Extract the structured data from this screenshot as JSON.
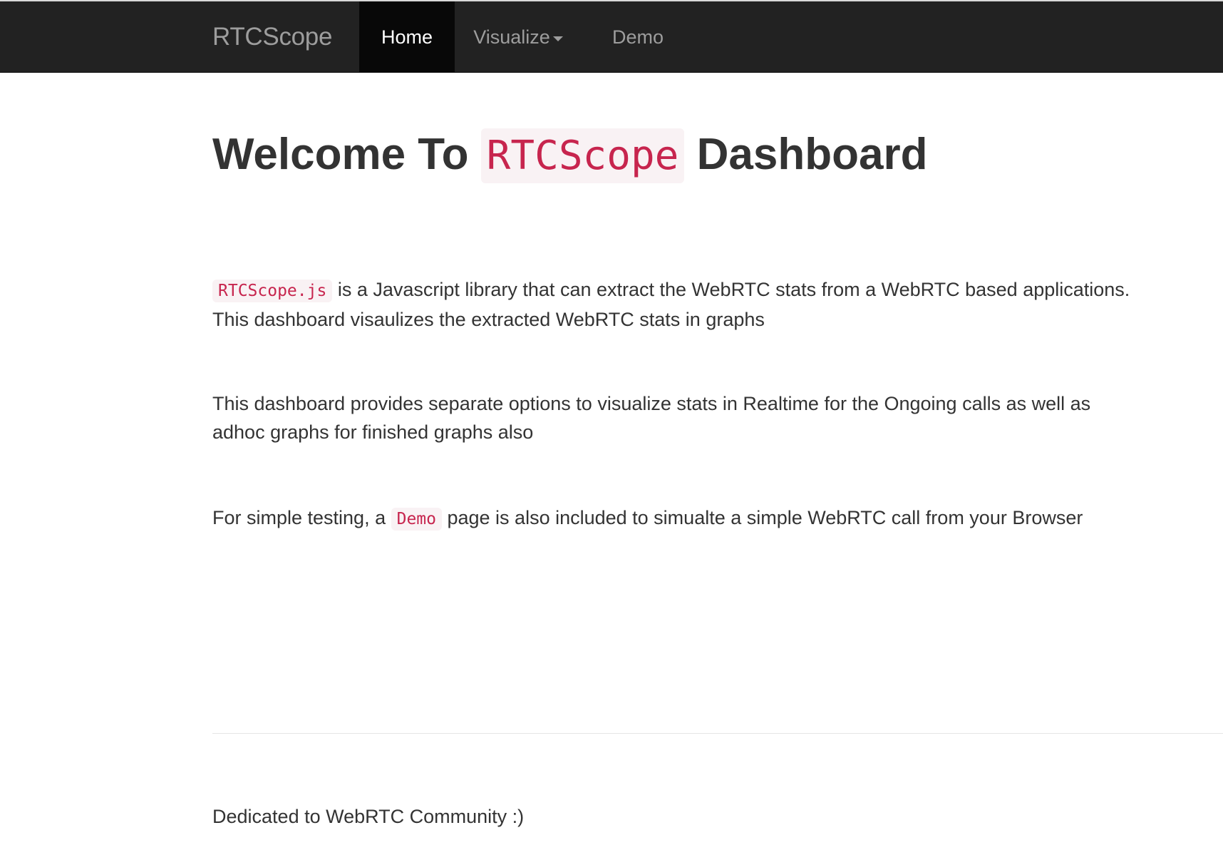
{
  "navbar": {
    "brand": "RTCScope",
    "items": [
      {
        "label": "Home",
        "active": true
      },
      {
        "label": "Visualize",
        "has_dropdown": true
      },
      {
        "label": "Demo"
      }
    ],
    "active_color": "#ffffff",
    "inactive_color": "#9d9d9d",
    "background": "#222222"
  },
  "main": {
    "title_prefix": "Welcome To",
    "title_code": "RTCScope",
    "title_suffix": "Dashboard",
    "paragraph1_code": "RTCScope.js",
    "paragraph1_text": " is a Javascript library that can extract the WebRTC stats from a WebRTC based applications. This dashboard visaulizes the extracted WebRTC stats in graphs",
    "paragraph2_text": "This dashboard provides separate options to visualize stats in Realtime for the Ongoing calls as well as adhoc graphs for finished graphs also",
    "paragraph3_before": "For simple testing, a ",
    "paragraph3_code": "Demo",
    "paragraph3_after": " page is also included to simualte a simple WebRTC call from your Browser",
    "code_color": "#c7254e"
  },
  "footer": {
    "text": "Dedicated to WebRTC Community :)"
  }
}
